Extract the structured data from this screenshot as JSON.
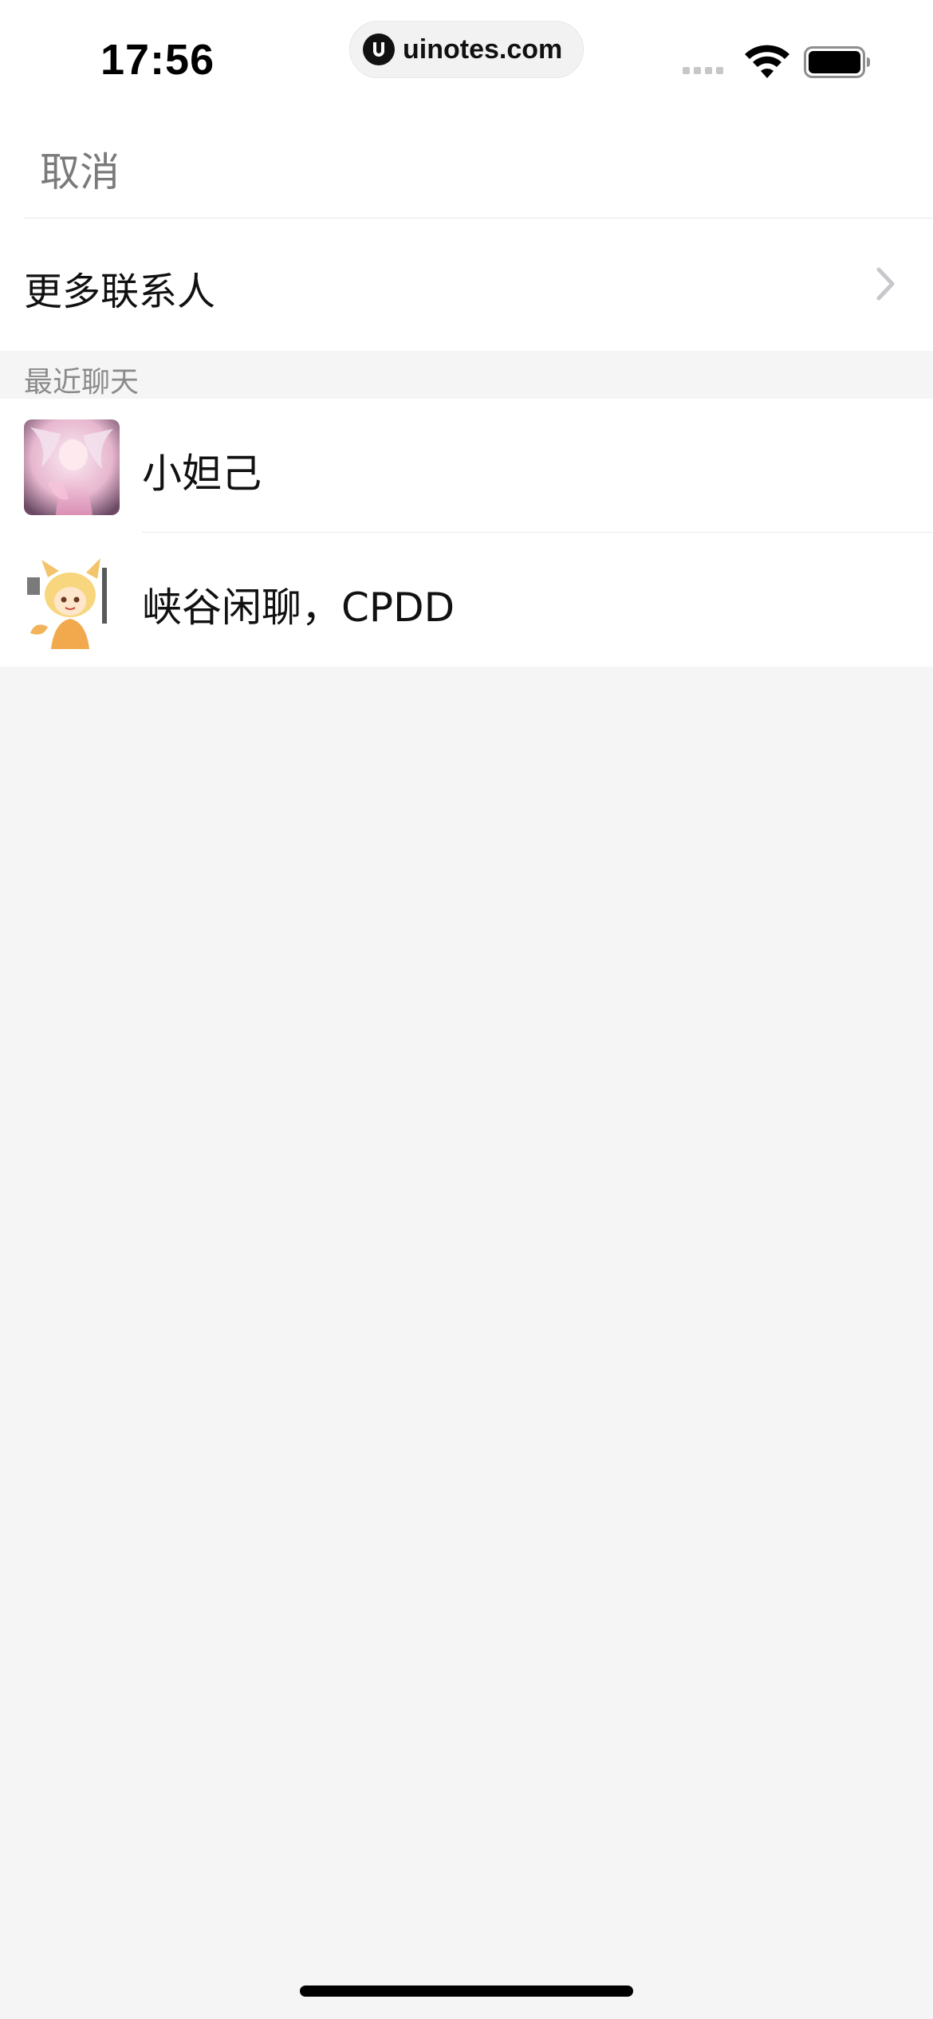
{
  "status_bar": {
    "time": "17:56",
    "url": "uinotes.com",
    "logo_letter": "U"
  },
  "header": {
    "cancel_label": "取消"
  },
  "more_contacts": {
    "label": "更多联系人"
  },
  "section": {
    "label": "最近聊天"
  },
  "chats": [
    {
      "name": "小妲己",
      "avatar_icon": "avatar-pink-anime"
    },
    {
      "name": "峡谷闲聊，CPDD",
      "avatar_icon": "avatar-fox-anime"
    }
  ],
  "colors": {
    "background": "#f5f5f5",
    "surface": "#ffffff",
    "secondary_text": "#7a7a7a",
    "section_text": "#8a8a8a",
    "chevron": "#c7c7cc"
  }
}
